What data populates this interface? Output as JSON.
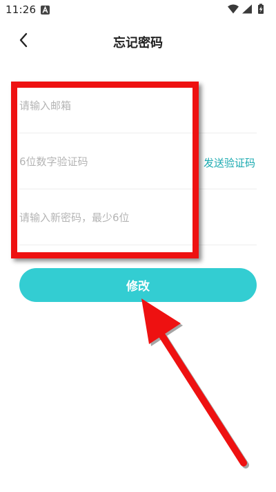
{
  "status_bar": {
    "time": "11:26",
    "app_icon": "notification-a-icon",
    "icons": [
      "wifi-icon",
      "signal-icon",
      "battery-charging-icon"
    ]
  },
  "header": {
    "title": "忘记密码",
    "back_icon": "chevron-left-icon"
  },
  "form": {
    "email_placeholder": "请输入邮箱",
    "code_placeholder": "6位数字验证码",
    "send_code_label": "发送验证码",
    "password_placeholder": "请输入新密码，最少6位"
  },
  "submit": {
    "label": "修改"
  },
  "colors": {
    "accent": "#33cdd2",
    "link": "#1aaab0",
    "annotation_red": "#ee1111",
    "placeholder": "#b4b4b4"
  }
}
